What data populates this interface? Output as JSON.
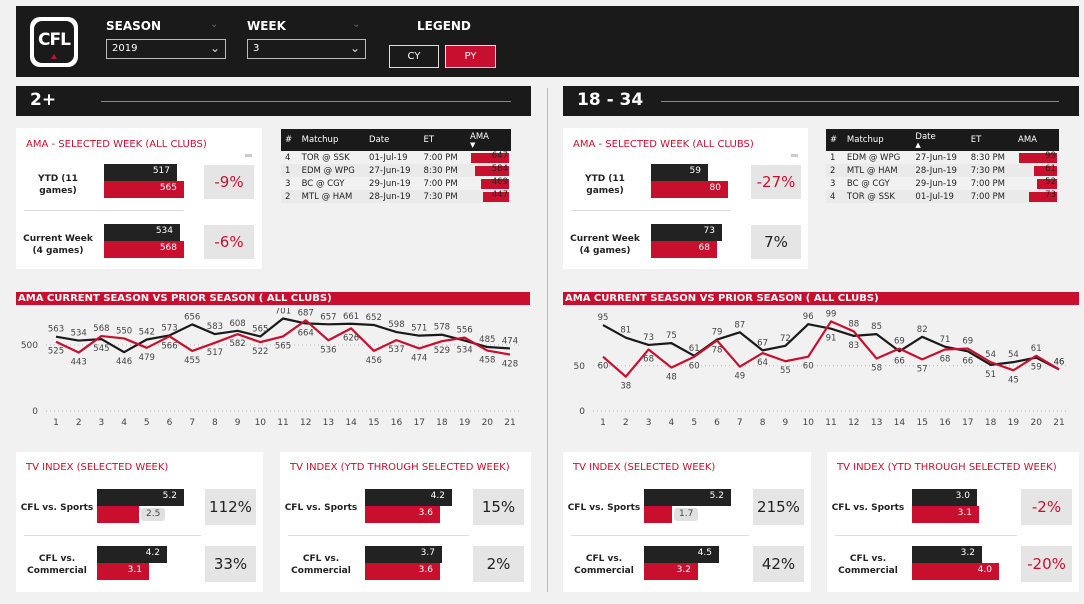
{
  "logo": {
    "text": "CFL"
  },
  "filters": {
    "season_label": "SEASON",
    "season_value": "2019",
    "week_label": "WEEK",
    "week_value": "3",
    "legend_label": "LEGEND",
    "legend_cy": "CY",
    "legend_py": "PY"
  },
  "colors": {
    "cy": "#1a1a1a",
    "py": "#c8102e",
    "bg": "#f1f1f1"
  },
  "sections": [
    {
      "title": "2+",
      "ama_title": "AMA - SELECTED WEEK (ALL CLUBS)",
      "ama": [
        {
          "label_1": "YTD (11",
          "label_2": "games)",
          "cy": "517",
          "py": "565",
          "cy_num": 517,
          "py_num": 565,
          "pct": "-9%",
          "pct_color": "#c8102e"
        },
        {
          "label_1": "Current Week",
          "label_2": "(4 games)",
          "cy": "534",
          "py": "568",
          "cy_num": 534,
          "py_num": 568,
          "pct": "-6%",
          "pct_color": "#c8102e"
        }
      ],
      "ama_max": 600,
      "table": {
        "headers": [
          "#",
          "Matchup",
          "Date",
          "ET",
          "AMA"
        ],
        "sort_col": 4,
        "rows": [
          {
            "n": "4",
            "matchup": "TOR @ SSK",
            "date": "01-Jul-19",
            "et": "7:00 PM",
            "ama": "647",
            "ama_num": 647
          },
          {
            "n": "1",
            "matchup": "EDM @ WPG",
            "date": "27-Jun-19",
            "et": "8:30 PM",
            "ama": "584",
            "ama_num": 584
          },
          {
            "n": "3",
            "matchup": "BC @ CGY",
            "date": "29-Jun-19",
            "et": "7:00 PM",
            "ama": "469",
            "ama_num": 469
          },
          {
            "n": "2",
            "matchup": "MTL @ HAM",
            "date": "28-Jun-19",
            "et": "7:30 PM",
            "ama": "447",
            "ama_num": 447
          }
        ],
        "max": 647
      },
      "chart": {
        "title": "AMA CURRENT SEASON VS PRIOR SEASON ( ALL CLUBS)",
        "chart_data": {
          "type": "line",
          "x": [
            1,
            2,
            3,
            4,
            5,
            6,
            7,
            8,
            9,
            10,
            11,
            12,
            13,
            14,
            15,
            16,
            17,
            18,
            19,
            20,
            21
          ],
          "series": [
            {
              "values": [
                563,
                534,
                545,
                446,
                542,
                573,
                656,
                583,
                608,
                565,
                701,
                664,
                657,
                661,
                652,
                598,
                571,
                578,
                534,
                485,
                474
              ]
            },
            {
              "values": [
                525,
                443,
                568,
                550,
                479,
                566,
                455,
                517,
                582,
                522,
                565,
                687,
                536,
                626,
                456,
                537,
                474,
                529,
                556,
                458,
                428
              ]
            }
          ],
          "ylim": [
            0,
            720
          ],
          "yticks": [
            "0",
            "500"
          ]
        }
      },
      "tv_selected": {
        "title": "TV INDEX (SELECTED WEEK)",
        "rows": [
          {
            "label_1": "CFL vs. Sports",
            "label_2": "",
            "cy": "5.2",
            "py": "2.5",
            "cy_num": 5.2,
            "py_num": 2.5,
            "py_grey": true,
            "pct": "112%",
            "pct_color": "#222"
          },
          {
            "label_1": "CFL vs.",
            "label_2": "Commercial",
            "cy": "4.2",
            "py": "3.1",
            "cy_num": 4.2,
            "py_num": 3.1,
            "py_grey": false,
            "pct": "33%",
            "pct_color": "#222"
          }
        ],
        "max": 5.2
      },
      "tv_ytd": {
        "title": "TV INDEX (YTD THROUGH SELECTED WEEK)",
        "rows": [
          {
            "label_1": "CFL vs. Sports",
            "label_2": "",
            "cy": "4.2",
            "py": "3.6",
            "cy_num": 4.2,
            "py_num": 3.6,
            "py_grey": false,
            "pct": "15%",
            "pct_color": "#222"
          },
          {
            "label_1": "CFL vs.",
            "label_2": "Commercial",
            "cy": "3.7",
            "py": "3.6",
            "cy_num": 3.7,
            "py_num": 3.6,
            "py_grey": false,
            "pct": "2%",
            "pct_color": "#222"
          }
        ],
        "max": 4.2
      }
    },
    {
      "title": "18 - 34",
      "ama_title": "AMA - SELECTED WEEK (ALL CLUBS)",
      "ama": [
        {
          "label_1": "YTD (11",
          "label_2": "games)",
          "cy": "59",
          "py": "80",
          "cy_num": 59,
          "py_num": 80,
          "pct": "-27%",
          "pct_color": "#c8102e"
        },
        {
          "label_1": "Current Week",
          "label_2": "(4 games)",
          "cy": "73",
          "py": "68",
          "cy_num": 73,
          "py_num": 68,
          "pct": "7%",
          "pct_color": "#222"
        }
      ],
      "ama_max": 88,
      "table": {
        "headers": [
          "#",
          "Matchup",
          "Date",
          "ET",
          "AMA"
        ],
        "sort_col": 2,
        "rows": [
          {
            "n": "1",
            "matchup": "EDM @ WPG",
            "date": "27-Jun-19",
            "et": "8:30 PM",
            "ama": "99",
            "ama_num": 99
          },
          {
            "n": "2",
            "matchup": "MTL @ HAM",
            "date": "28-Jun-19",
            "et": "7:30 PM",
            "ama": "61",
            "ama_num": 61
          },
          {
            "n": "3",
            "matchup": "BC @ CGY",
            "date": "29-Jun-19",
            "et": "7:00 PM",
            "ama": "52",
            "ama_num": 52
          },
          {
            "n": "4",
            "matchup": "TOR @ SSK",
            "date": "01-Jul-19",
            "et": "7:00 PM",
            "ama": "73",
            "ama_num": 73
          }
        ],
        "max": 99
      },
      "chart": {
        "title": "AMA CURRENT SEASON VS PRIOR SEASON ( ALL CLUBS)",
        "chart_data": {
          "type": "line",
          "x": [
            1,
            2,
            3,
            4,
            5,
            6,
            7,
            8,
            9,
            10,
            11,
            12,
            13,
            14,
            15,
            16,
            17,
            18,
            19,
            20,
            21
          ],
          "series": [
            {
              "values": [
                95,
                81,
                73,
                75,
                61,
                79,
                87,
                67,
                72,
                96,
                91,
                83,
                85,
                66,
                82,
                71,
                66,
                51,
                54,
                59,
                46
              ]
            },
            {
              "values": [
                60,
                38,
                68,
                48,
                60,
                78,
                49,
                64,
                55,
                60,
                99,
                88,
                58,
                69,
                57,
                68,
                69,
                54,
                45,
                61,
                46
              ]
            }
          ],
          "ylim": [
            0,
            105
          ],
          "yticks": [
            "0",
            "50"
          ]
        }
      },
      "tv_selected": {
        "title": "TV INDEX (SELECTED WEEK)",
        "rows": [
          {
            "label_1": "CFL vs. Sports",
            "label_2": "",
            "cy": "5.2",
            "py": "1.7",
            "cy_num": 5.2,
            "py_num": 1.7,
            "py_grey": true,
            "pct": "215%",
            "pct_color": "#222"
          },
          {
            "label_1": "CFL vs.",
            "label_2": "Commercial",
            "cy": "4.5",
            "py": "3.2",
            "cy_num": 4.5,
            "py_num": 3.2,
            "py_grey": false,
            "pct": "42%",
            "pct_color": "#222"
          }
        ],
        "max": 5.2
      },
      "tv_ytd": {
        "title": "TV INDEX (YTD THROUGH SELECTED WEEK)",
        "rows": [
          {
            "label_1": "CFL vs. Sports",
            "label_2": "",
            "cy": "3.0",
            "py": "3.1",
            "cy_num": 3.0,
            "py_num": 3.1,
            "py_grey": false,
            "pct": "-2%",
            "pct_color": "#c8102e"
          },
          {
            "label_1": "CFL vs.",
            "label_2": "Commercial",
            "cy": "3.2",
            "py": "4.0",
            "cy_num": 3.2,
            "py_num": 4.0,
            "py_grey": false,
            "pct": "-20%",
            "pct_color": "#c8102e"
          }
        ],
        "max": 4.0
      }
    }
  ]
}
